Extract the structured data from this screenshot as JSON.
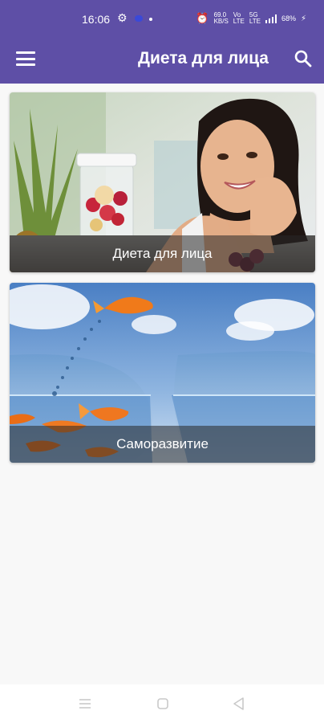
{
  "status_bar": {
    "time": "16:06",
    "net_speed": "69.0\nKB/S",
    "net_type_1": "Vo\nLTE",
    "net_type_2": "5G\nLTE",
    "battery": "68%",
    "icons": [
      "gear-icon",
      "alarm-icon",
      "signal-icon",
      "battery-charging-icon"
    ]
  },
  "app_bar": {
    "title": "Диета для лица",
    "menu_icon": "menu-icon",
    "search_icon": "search-icon",
    "color": "#5e4fa6"
  },
  "cards": [
    {
      "caption": "Диета для лица",
      "image": "woman-smoothie-photo"
    },
    {
      "caption": "Саморазвитие",
      "image": "goldfish-bowls-photo"
    }
  ],
  "nav_bar": {
    "icons": [
      "recent-apps-icon",
      "home-icon",
      "back-icon"
    ]
  }
}
